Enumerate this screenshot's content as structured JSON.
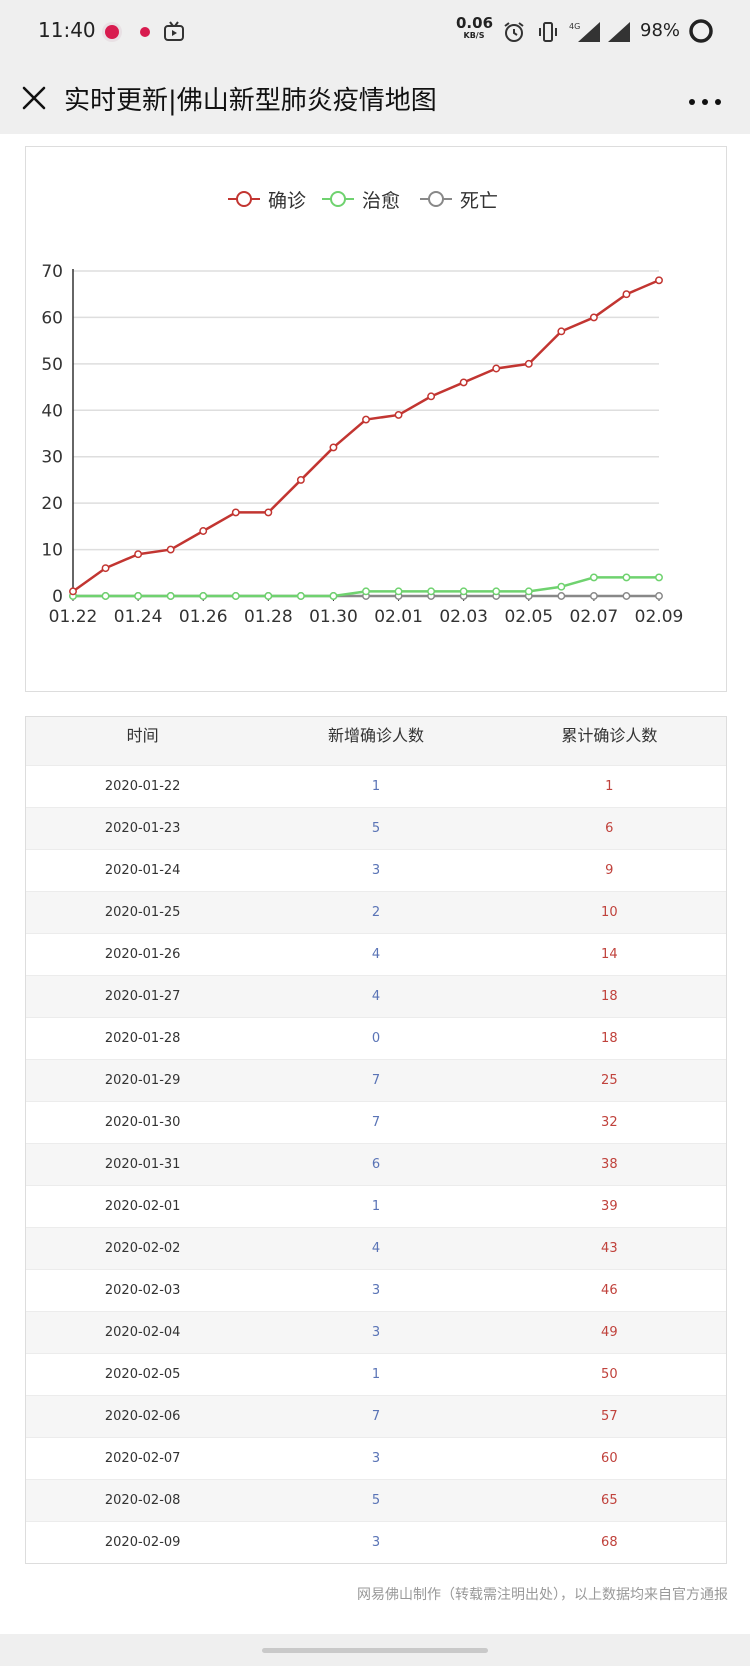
{
  "status": {
    "time": "11:40",
    "net_speed": "0.06",
    "net_unit": "KB/S",
    "signal_tag": "4G",
    "battery": "98%"
  },
  "titlebar": {
    "title": "实时更新|佛山新型肺炎疫情地图"
  },
  "chart_data": {
    "type": "line",
    "x": [
      "01.22",
      "01.23",
      "01.24",
      "01.25",
      "01.26",
      "01.27",
      "01.28",
      "01.29",
      "01.30",
      "01.31",
      "02.01",
      "02.02",
      "02.03",
      "02.04",
      "02.05",
      "02.06",
      "02.07",
      "02.08",
      "02.09"
    ],
    "x_tick_labels": [
      "01.22",
      "01.24",
      "01.26",
      "01.28",
      "01.30",
      "02.01",
      "02.03",
      "02.05",
      "02.07",
      "02.09"
    ],
    "y_ticks": [
      0,
      10,
      20,
      30,
      40,
      50,
      60,
      70
    ],
    "ylim": [
      0,
      70
    ],
    "grid": true,
    "legend_position": "top-center",
    "series": [
      {
        "name": "确诊",
        "color": "#c23531",
        "values": [
          1,
          6,
          9,
          10,
          14,
          18,
          18,
          25,
          32,
          38,
          39,
          43,
          46,
          49,
          50,
          57,
          60,
          65,
          68
        ]
      },
      {
        "name": "治愈",
        "color": "#6fd26f",
        "values": [
          0,
          0,
          0,
          0,
          0,
          0,
          0,
          0,
          0,
          1,
          1,
          1,
          1,
          1,
          1,
          2,
          4,
          4,
          4
        ]
      },
      {
        "name": "死亡",
        "color": "#888888",
        "values": [
          0,
          0,
          0,
          0,
          0,
          0,
          0,
          0,
          0,
          0,
          0,
          0,
          0,
          0,
          0,
          0,
          0,
          0,
          0
        ]
      }
    ]
  },
  "table": {
    "headers": [
      "时间",
      "新增确诊人数",
      "累计确诊人数"
    ],
    "rows": [
      [
        "2020-01-22",
        "1",
        "1"
      ],
      [
        "2020-01-23",
        "5",
        "6"
      ],
      [
        "2020-01-24",
        "3",
        "9"
      ],
      [
        "2020-01-25",
        "2",
        "10"
      ],
      [
        "2020-01-26",
        "4",
        "14"
      ],
      [
        "2020-01-27",
        "4",
        "18"
      ],
      [
        "2020-01-28",
        "0",
        "18"
      ],
      [
        "2020-01-29",
        "7",
        "25"
      ],
      [
        "2020-01-30",
        "7",
        "32"
      ],
      [
        "2020-01-31",
        "6",
        "38"
      ],
      [
        "2020-02-01",
        "1",
        "39"
      ],
      [
        "2020-02-02",
        "4",
        "43"
      ],
      [
        "2020-02-03",
        "3",
        "46"
      ],
      [
        "2020-02-04",
        "3",
        "49"
      ],
      [
        "2020-02-05",
        "1",
        "50"
      ],
      [
        "2020-02-06",
        "7",
        "57"
      ],
      [
        "2020-02-07",
        "3",
        "60"
      ],
      [
        "2020-02-08",
        "5",
        "65"
      ],
      [
        "2020-02-09",
        "3",
        "68"
      ]
    ]
  },
  "footer": {
    "note": "网易佛山制作（转载需注明出处），以上数据均来自官方通报"
  }
}
